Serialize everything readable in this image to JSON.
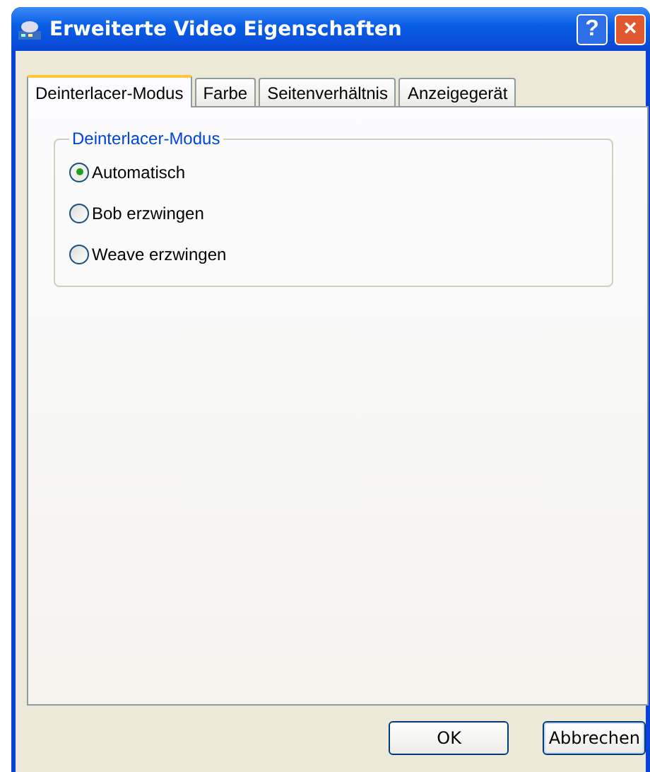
{
  "window": {
    "title": "Erweiterte Video Eigenschaften",
    "help_button": "?",
    "close_button": "×"
  },
  "tabs": [
    {
      "label": "Deinterlacer-Modus",
      "selected": true
    },
    {
      "label": "Farbe",
      "selected": false
    },
    {
      "label": "Seitenverhältnis",
      "selected": false
    },
    {
      "label": "Anzeigegerät",
      "selected": false
    }
  ],
  "group": {
    "title": "Deinterlacer-Modus",
    "options": [
      {
        "label": "Automatisch",
        "selected": true
      },
      {
        "label": "Bob erzwingen",
        "selected": false
      },
      {
        "label": "Weave erzwingen",
        "selected": false
      }
    ]
  },
  "buttons": [
    {
      "label": "OK",
      "focused": false
    },
    {
      "label": "Abbrechen",
      "focused": true
    }
  ]
}
